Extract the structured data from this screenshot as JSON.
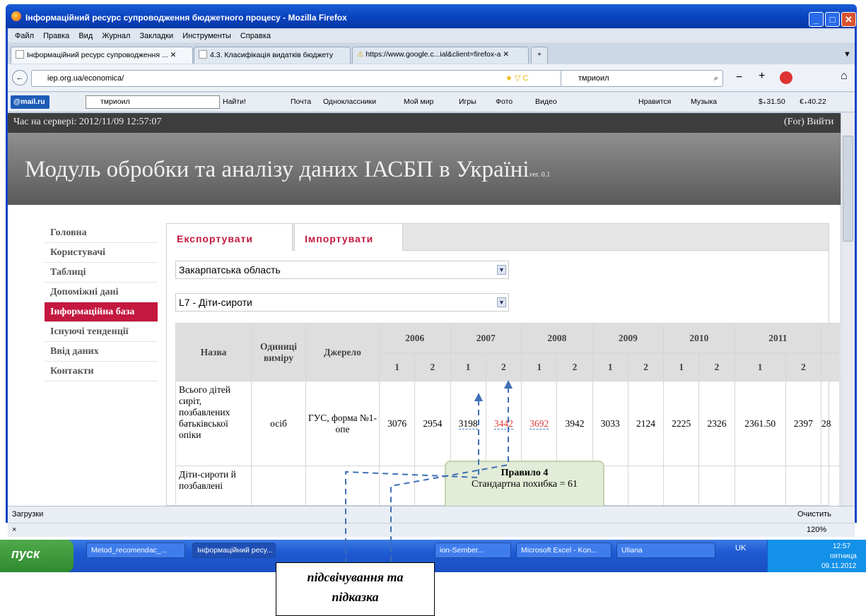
{
  "window": {
    "title": "Інформаційний ресурс супроводження бюджетного процесу - Mozilla Firefox"
  },
  "menu": [
    "Файл",
    "Правка",
    "Вид",
    "Журнал",
    "Закладки",
    "Инструменты",
    "Справка"
  ],
  "tabs": [
    {
      "label": "Інформаційний ресурс супроводження ..."
    },
    {
      "label": "4.3. Класифікація видатків бюджету"
    },
    {
      "label": "https://www.google.c...ial&client=firefox-a"
    }
  ],
  "address": {
    "url": "iep.org.ua/economica/",
    "search": "тмриоил"
  },
  "toolbar": {
    "mail": "@mail.ru",
    "search_value": "тмриоил",
    "find": "Найти!",
    "items": [
      "Почта",
      "Одноклассники",
      "Мой мир",
      "Игры",
      "Фото",
      "Видео"
    ],
    "right_items": [
      "Нравится",
      "Музыка",
      "$₊31.50",
      "€₊40.22"
    ]
  },
  "site": {
    "server_time": "Час на сервері: 2012/11/09 12:57:07",
    "user": "(For) Вийти",
    "title": "Модуль обробки та аналізу даних ІАСБП в Україні",
    "version": "ver. 0.1"
  },
  "sidenav": [
    "Головна",
    "Користувачі",
    "Таблиці",
    "Допоміжні дані",
    "Інформаційна база",
    "Існуючі тенденції",
    "Ввід даних",
    "Контакти"
  ],
  "panel": {
    "tab_export": "Експортувати",
    "tab_import": "Імпортувати",
    "region": "Закарпатська область",
    "indicator": "L7 - Діти-сироти"
  },
  "table": {
    "headers": {
      "name": "Назва",
      "unit": "Одиниці виміру",
      "source": "Джерело"
    },
    "years": [
      "2006",
      "2007",
      "2008",
      "2009",
      "2010",
      "2011"
    ],
    "halves": [
      "1",
      "2"
    ],
    "row1": {
      "name": "Всього дітей сиріт, позбавлених батьківської опіки",
      "unit": "осіб",
      "source": "ГУС, форма №1-опе",
      "values": [
        "3076",
        "2954",
        "3198",
        "3442",
        "3692",
        "3942",
        "3033",
        "2124",
        "2225",
        "2326",
        "2361.50",
        "2397",
        "28"
      ]
    },
    "row2": {
      "name": "Діти-сироти й позбавлені"
    }
  },
  "tooltip": {
    "title": "Правило 4",
    "text": "Стандартна похибка = 61"
  },
  "downloads": {
    "label": "Загрузки",
    "clear": "Очистить"
  },
  "status": {
    "zoom": "120%"
  },
  "taskbar": {
    "start": "пуск",
    "items": [
      "Metod_recomendac_...",
      "Інформаційний ресу...",
      "ion-Sember...",
      "Microsoft Excel - Kon...",
      "Uliana"
    ],
    "lang": "UK",
    "time": "12:57",
    "day": "пятница",
    "date": "09.11.2012"
  },
  "callout": {
    "line1": "підсвічування та",
    "line2": "підказка"
  }
}
